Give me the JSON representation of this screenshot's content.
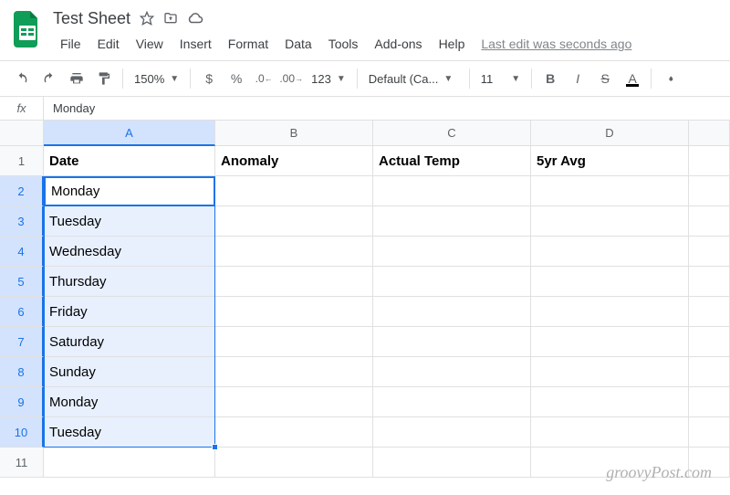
{
  "header": {
    "doc_title": "Test Sheet",
    "last_edit": "Last edit was seconds ago",
    "menu": [
      "File",
      "Edit",
      "View",
      "Insert",
      "Format",
      "Data",
      "Tools",
      "Add-ons",
      "Help"
    ]
  },
  "toolbar": {
    "zoom": "150%",
    "font": "Default (Ca...",
    "font_size": "11"
  },
  "formula_bar": {
    "label": "fx",
    "value": "Monday"
  },
  "columns": [
    "A",
    "B",
    "C",
    "D"
  ],
  "row_count": 11,
  "selected_rows": [
    2,
    3,
    4,
    5,
    6,
    7,
    8,
    9,
    10
  ],
  "active_cell": {
    "row": 2,
    "col": "A"
  },
  "cells": {
    "header_row": [
      "Date",
      "Anomaly",
      "Actual Temp",
      "5yr Avg"
    ],
    "col_a_values": [
      "Monday",
      "Tuesday",
      "Wednesday",
      "Thursday",
      "Friday",
      "Saturday",
      "Sunday",
      "Monday",
      "Tuesday"
    ]
  },
  "watermark": "groovyPost.com"
}
